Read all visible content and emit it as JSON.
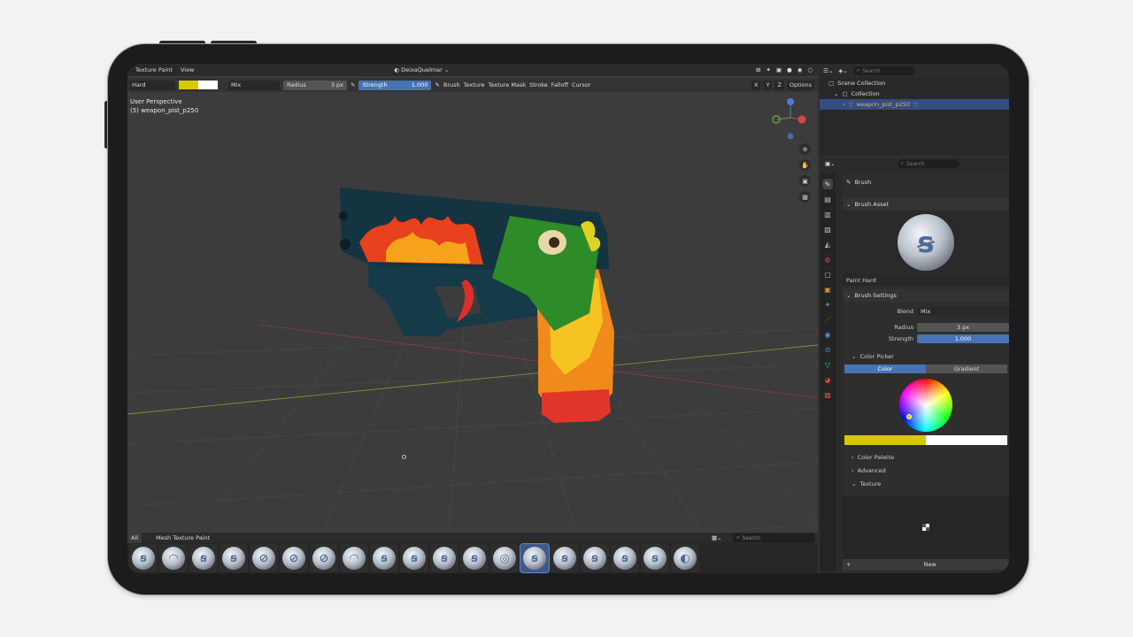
{
  "header": {
    "mode": "Texture Paint",
    "view_menu": "View",
    "object_name": "DeixaQuelmar"
  },
  "tool_settings": {
    "brush_preset": "Hard",
    "blend": "Mix",
    "radius_label": "Radius",
    "radius_value": "3 px",
    "strength_label": "Strength",
    "strength_value": "1.000",
    "menus": [
      "Brush",
      "Texture",
      "Texture Mask",
      "Stroke",
      "Falloff",
      "Cursor"
    ],
    "axes": [
      "X",
      "Y",
      "Z"
    ],
    "options": "Options",
    "primary_color": "#d8c800",
    "secondary_color": "#ffffff"
  },
  "viewport": {
    "view_name": "User Perspective",
    "object_info": "(5) weapon_pist_p250"
  },
  "asset_shelf": {
    "tab_all": "All",
    "tab_mesh": "Mesh Texture Paint",
    "search_placeholder": "Search",
    "brush_count": 19,
    "selected_index": 13
  },
  "outliner": {
    "search_placeholder": "Search",
    "scene_collection": "Scene Collection",
    "collection": "Collection",
    "object": "weapon_pist_p250"
  },
  "properties": {
    "search_placeholder": "Search",
    "tool_name": "Brush",
    "brush_asset_title": "Brush Asset",
    "brush_asset_name": "Paint Hard",
    "brush_settings_title": "Brush Settings",
    "blend_label": "Blend",
    "blend_value": "Mix",
    "radius_label": "Radius",
    "radius_value": "3 px",
    "strength_label": "Strength",
    "strength_value": "1.000",
    "color_picker_title": "Color Picker",
    "color_tab": "Color",
    "gradient_tab": "Gradient",
    "color_palette": "Color Palette",
    "advanced": "Advanced",
    "texture": "Texture",
    "new_button": "New"
  }
}
